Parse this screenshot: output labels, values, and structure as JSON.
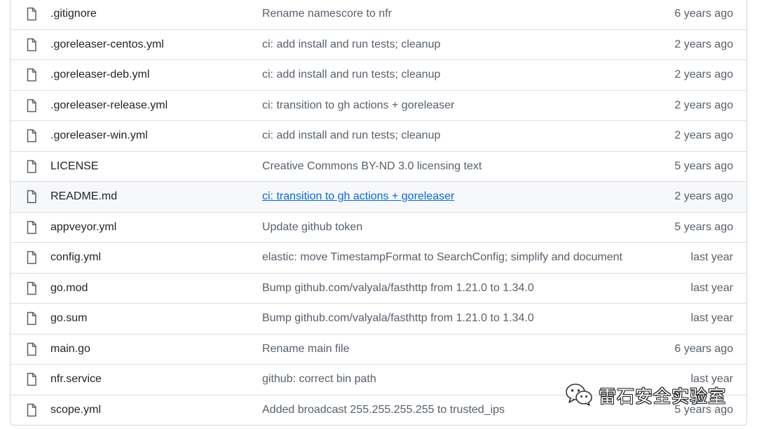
{
  "files": [
    {
      "name": ".gitignore",
      "message": "Rename namescore to nfr",
      "age": "6 years ago"
    },
    {
      "name": ".goreleaser-centos.yml",
      "message": "ci: add install and run tests; cleanup",
      "age": "2 years ago"
    },
    {
      "name": ".goreleaser-deb.yml",
      "message": "ci: add install and run tests; cleanup",
      "age": "2 years ago"
    },
    {
      "name": ".goreleaser-release.yml",
      "message": "ci: transition to gh actions + goreleaser",
      "age": "2 years ago"
    },
    {
      "name": ".goreleaser-win.yml",
      "message": "ci: add install and run tests; cleanup",
      "age": "2 years ago"
    },
    {
      "name": "LICENSE",
      "message": "Creative Commons BY-ND 3.0 licensing text",
      "age": "5 years ago"
    },
    {
      "name": "README.md",
      "message": "ci: transition to gh actions + goreleaser",
      "age": "2 years ago",
      "hovered": true
    },
    {
      "name": "appveyor.yml",
      "message": "Update github token",
      "age": "5 years ago"
    },
    {
      "name": "config.yml",
      "message": "elastic: move TimestampFormat to SearchConfig; simplify and document",
      "age": "last year"
    },
    {
      "name": "go.mod",
      "message": "Bump github.com/valyala/fasthttp from 1.21.0 to 1.34.0",
      "age": "last year"
    },
    {
      "name": "go.sum",
      "message": "Bump github.com/valyala/fasthttp from 1.21.0 to 1.34.0",
      "age": "last year"
    },
    {
      "name": "main.go",
      "message": "Rename main file",
      "age": "6 years ago"
    },
    {
      "name": "nfr.service",
      "message": "github: correct bin path",
      "age": "last year"
    },
    {
      "name": "scope.yml",
      "message": "Added broadcast 255.255.255.255 to trusted_ips",
      "age": "5 years ago"
    }
  ],
  "icons": {
    "file": "file-icon",
    "watermark": "wechat-icon"
  },
  "colors": {
    "text": "#1f2328",
    "muted": "#57606a",
    "link": "#0969da",
    "border": "#d0d7de",
    "row_hover": "#f6f8fa"
  },
  "watermark": {
    "text": "雷石安全实验室"
  }
}
